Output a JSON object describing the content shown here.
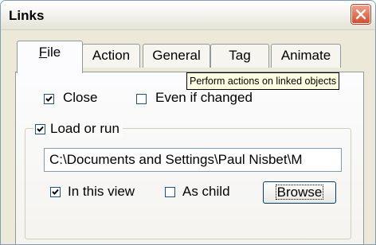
{
  "window": {
    "title": "Links"
  },
  "tabs": [
    {
      "label_ul": "F",
      "label_rest": "ile",
      "active": true
    },
    {
      "label": "Action"
    },
    {
      "label": "General"
    },
    {
      "label": "Tag"
    },
    {
      "label": "Animate"
    }
  ],
  "tooltip": {
    "text": "Perform actions on linked objects"
  },
  "options": {
    "close": {
      "label": "Close",
      "checked": true
    },
    "even_if_changed": {
      "label": "Even if changed",
      "checked": false
    }
  },
  "load_group": {
    "label": "Load or run",
    "checked": true,
    "path_value": "C:\\Documents and Settings\\Paul Nisbet\\M",
    "in_this_view": {
      "label": "In this view",
      "checked": true
    },
    "as_child": {
      "label": "As child",
      "checked": false
    },
    "browse_label": "Browse"
  },
  "icons": {
    "close": "close-icon",
    "check": "checkmark-icon"
  }
}
